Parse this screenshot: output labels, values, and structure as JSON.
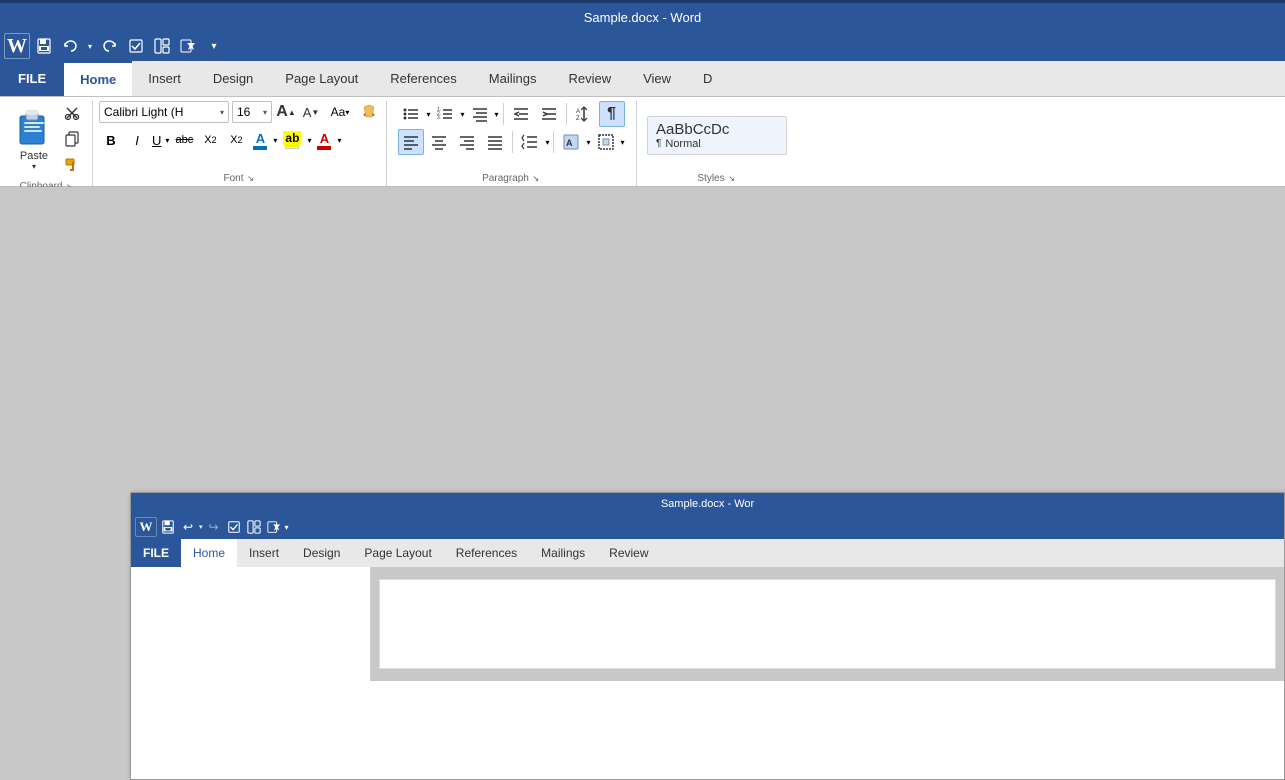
{
  "titleBar": {
    "title": "Sample.docx - Word"
  },
  "quickAccess": {
    "buttons": [
      "save",
      "undo",
      "redo",
      "check",
      "layout",
      "custom",
      "more"
    ]
  },
  "ribbonTabs": {
    "tabs": [
      "FILE",
      "Home",
      "Insert",
      "Design",
      "Page Layout",
      "References",
      "Mailings",
      "Review",
      "View",
      "D"
    ]
  },
  "clipboard": {
    "label": "Clipboard",
    "paste": "Paste"
  },
  "font": {
    "label": "Font",
    "fontName": "Calibri Light (H",
    "fontSize": "16",
    "buttons": {
      "growFont": "A",
      "shrinkFont": "A",
      "changeCase": "Aa",
      "clearFormat": "✗"
    },
    "formatButtons": {
      "bold": "B",
      "italic": "I",
      "underline": "U",
      "strikethrough": "abc",
      "subscript": "X₂",
      "superscript": "X²"
    }
  },
  "paragraph": {
    "label": "Paragraph"
  },
  "styles": {
    "label": "Styles",
    "current": "Normal",
    "preview": "AaBbCcDc"
  },
  "window2": {
    "title": "Sample.docx - Wor",
    "tabs": [
      "FILE",
      "Home",
      "Insert",
      "Design",
      "Page Layout",
      "References",
      "Mailings",
      "Review"
    ]
  }
}
